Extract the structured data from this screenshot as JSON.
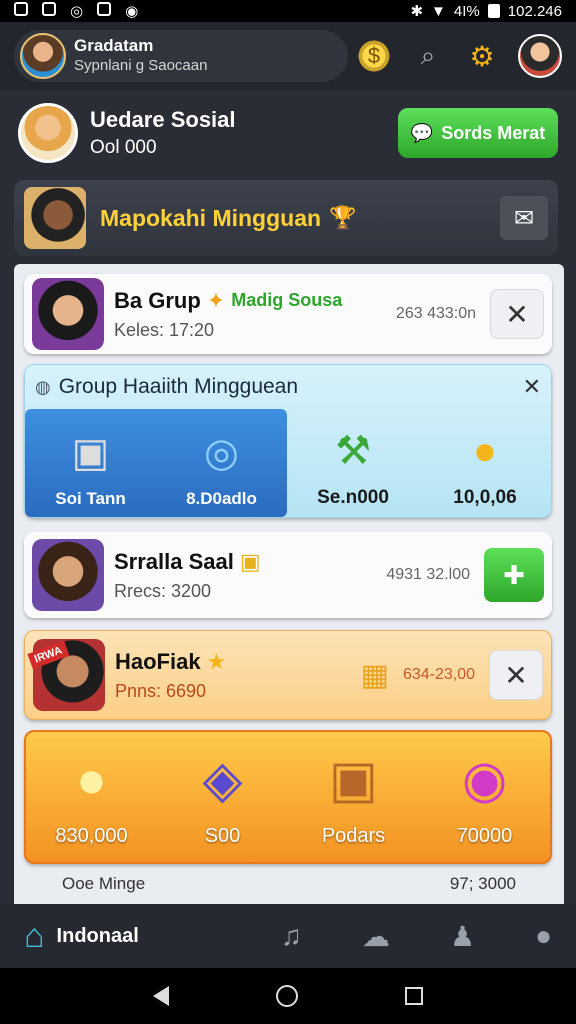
{
  "status_bar": {
    "battery": "4I%",
    "time": "102.246"
  },
  "header": {
    "profile_name": "Gradatam",
    "profile_sub": "Sypnlani g Saocaan",
    "icons": [
      "coin-icon",
      "search-icon",
      "gear-icon",
      "avatar"
    ]
  },
  "user": {
    "name": "Uedare Sosial",
    "score": "Ool 000",
    "action_label": "Sords Merat"
  },
  "banner": {
    "title": "Mapokahi Mingguan"
  },
  "cards": {
    "group": {
      "title": "Ba Grup",
      "badge": "Madig Sousa",
      "sub": "Keles: 17:20",
      "value": "263 433:0n"
    },
    "weekly_group": {
      "title": "Group Haaiith Mingguean",
      "items": [
        "Soi Tann",
        "8.D0adlo",
        "Se.n000",
        "10,0,06"
      ]
    },
    "user1": {
      "title": "Srralla Saal",
      "sub": "Rrecs: 3200",
      "value": "4931 32.l00"
    },
    "user2": {
      "title": "HaoFiak",
      "sub": "Pnns: 6690",
      "value": "634-23,00",
      "ribbon": "IRWA"
    },
    "rewards": {
      "items": [
        "830,000",
        "S00",
        "Podars",
        "70000"
      ]
    }
  },
  "footer": {
    "left": "Ooe Minge",
    "right": "97; 3000"
  },
  "bottom_nav": {
    "label": "Indonaal"
  }
}
